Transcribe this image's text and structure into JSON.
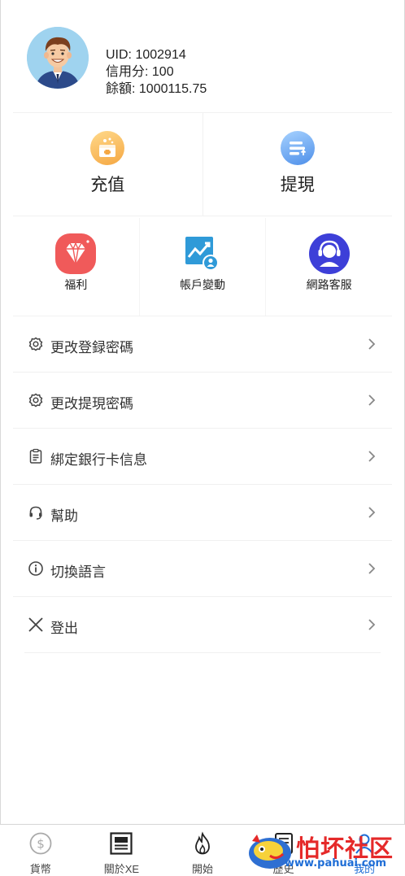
{
  "profile": {
    "uid": "UID: 1002914",
    "credit": "信用分: 100",
    "balance": "餘額: 1000115.75"
  },
  "actions": {
    "recharge_label": "充值",
    "withdraw_label": "提現"
  },
  "grid": {
    "welfare_label": "福利",
    "account_changes_label": "帳戶變動",
    "support_label": "網路客服"
  },
  "menu": {
    "items": [
      {
        "label": "更改登録密碼",
        "icon": "gear-icon"
      },
      {
        "label": "更改提現密碼",
        "icon": "gear-icon"
      },
      {
        "label": "綁定銀行卡信息",
        "icon": "clipboard-icon"
      },
      {
        "label": "幫助",
        "icon": "headset-icon"
      },
      {
        "label": "切換語言",
        "icon": "info-icon"
      },
      {
        "label": "登出",
        "icon": "close-icon"
      }
    ]
  },
  "tabbar": {
    "tabs": [
      {
        "label": "貨幣",
        "icon": "dollar-icon"
      },
      {
        "label": "關於XE",
        "icon": "newspaper-icon"
      },
      {
        "label": "開始",
        "icon": "flame-icon"
      },
      {
        "label": "歷史",
        "icon": "history-icon"
      },
      {
        "label": "我的",
        "icon": "user-icon"
      }
    ]
  },
  "watermark": {
    "text": "怕坏社区",
    "url": "www.pahuai.com"
  },
  "colors": {
    "recharge_gold": "#f5a742",
    "withdraw_blue": "#4e8fe9",
    "welfare_red": "#f05a5a",
    "chart_blue": "#2f9ad8",
    "support_indigo": "#3d3fd8"
  }
}
